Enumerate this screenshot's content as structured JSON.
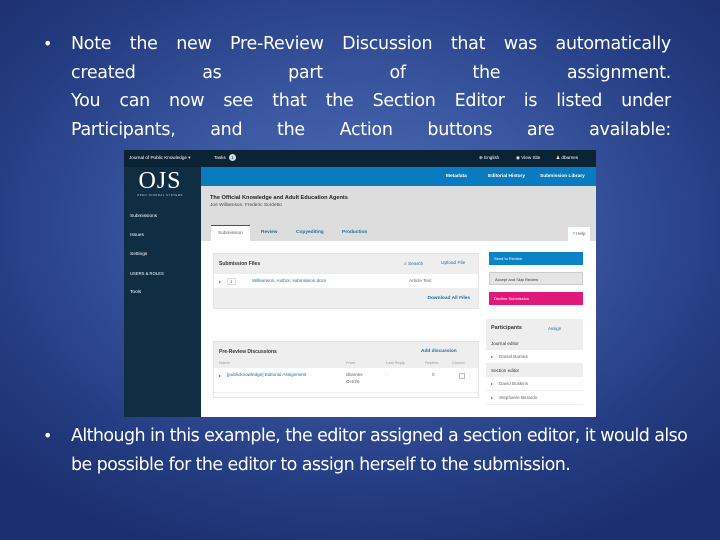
{
  "slide": {
    "bullet_symbol": "•",
    "bullet1_lines": [
      "Note the new Pre-Review Discussion that was automatically",
      "created as part of the assignment.",
      "You can now see that the Section Editor is listed under",
      "Participants, and the Action buttons are available:"
    ],
    "bullet2": "Although in this example, the editor assigned a section editor, it would also be possible for the editor to assign herself to the submission.",
    "background_color": "#2f4a94",
    "text_color": "#ffffff"
  },
  "ojs": {
    "topbar": {
      "journal_name": "Journal of Public Knowledge",
      "dropdown_glyph": "▾",
      "tasks_label": "Tasks",
      "tasks_count": "1",
      "language": "English",
      "view_site": "View Site",
      "user": "dbarnes",
      "globe_glyph": "⊕",
      "eye_glyph": "◉",
      "user_glyph": "♟"
    },
    "sidebar": {
      "logo": "OJS",
      "logo_sub": "OPEN JOURNAL SYSTEMS",
      "items": [
        "Submissions",
        "Issues",
        "Settings",
        "USERS & ROLES",
        "Tools"
      ]
    },
    "header_links": [
      "Metadata",
      "Editorial History",
      "Submission Library"
    ],
    "submission": {
      "title": "The Official Knowledge and Adult Education Agents",
      "authors": "Joe Williamson, Frederic Sordetto"
    },
    "tabs": [
      "Submission",
      "Review",
      "Copyediting",
      "Production"
    ],
    "help_label": "Help",
    "help_glyph": "?",
    "files_panel": {
      "title": "Submission Files",
      "search_label": "Search",
      "search_glyph": "⌕",
      "upload_label": "Upload File",
      "file_id": "1",
      "file_name": "Williamson, Author, submission.docx",
      "file_type": "Article Text",
      "download_all": "Download All Files"
    },
    "actions": {
      "send_to_review": "Send to Review",
      "accept_skip": "Accept and Skip Review",
      "decline": "Decline Submission"
    },
    "discussions": {
      "title": "Pre-Review Discussions",
      "add_label": "Add discussion",
      "columns": [
        "Name",
        "From",
        "Last Reply",
        "Replies",
        "Closed"
      ],
      "rows": [
        {
          "name": "[publicknowledge] Editorial Assignment",
          "from_user": "dbarnes",
          "from_date": "Oct/26",
          "last_reply": "-",
          "replies": "0",
          "closed": false
        }
      ]
    },
    "participants": {
      "title": "Participants",
      "assign_label": "Assign",
      "groups": [
        {
          "role": "Journal editor",
          "members": [
            "Daniel Barnes"
          ]
        },
        {
          "role": "Section editor",
          "members": [
            "David Buskins",
            "Stephanie Berardo"
          ]
        }
      ]
    },
    "colors": {
      "topbar": "#0b2435",
      "sidebar": "#0f2d43",
      "header": "#0b7bbf",
      "primary_button": "#0b83c6",
      "danger_button": "#e0187c",
      "link": "#1a6fa0"
    }
  }
}
